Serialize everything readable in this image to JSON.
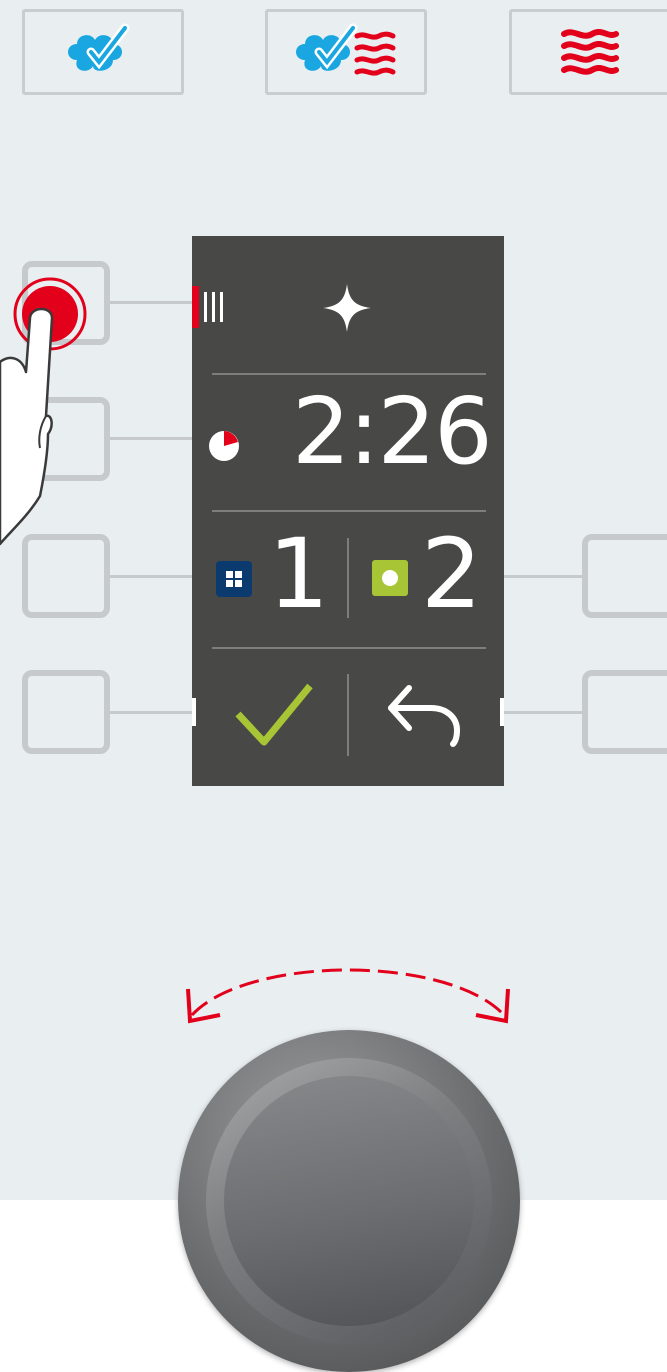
{
  "top_modes": [
    {
      "name": "steam",
      "icon": "steam-icon"
    },
    {
      "name": "combi",
      "icon": "steam-hot-air-icon"
    },
    {
      "name": "hot_air",
      "icon": "hot-air-icon"
    }
  ],
  "display": {
    "top_row": {
      "icon_left": "fan-speed-icon",
      "icon_right": "sparkle-icon"
    },
    "timer": {
      "icon": "timer-icon",
      "value": "2:26"
    },
    "shelves": {
      "left": {
        "icon": "tray-grid-icon",
        "value": "1"
      },
      "right": {
        "icon": "tray-single-icon",
        "value": "2"
      }
    },
    "actions": {
      "confirm_icon": "checkmark-icon",
      "back_icon": "back-arrow-icon"
    }
  },
  "control_knob": {
    "icon": "rotate-arrows-icon"
  },
  "colors": {
    "panel_background": "#e9eef1",
    "display_background": "#484846",
    "steam_blue": "#1aa7e1",
    "heat_red": "#e2001a",
    "confirm_green": "#a8c536",
    "tray_navy": "#0b3a6f",
    "button_outline": "#c6cacd"
  }
}
